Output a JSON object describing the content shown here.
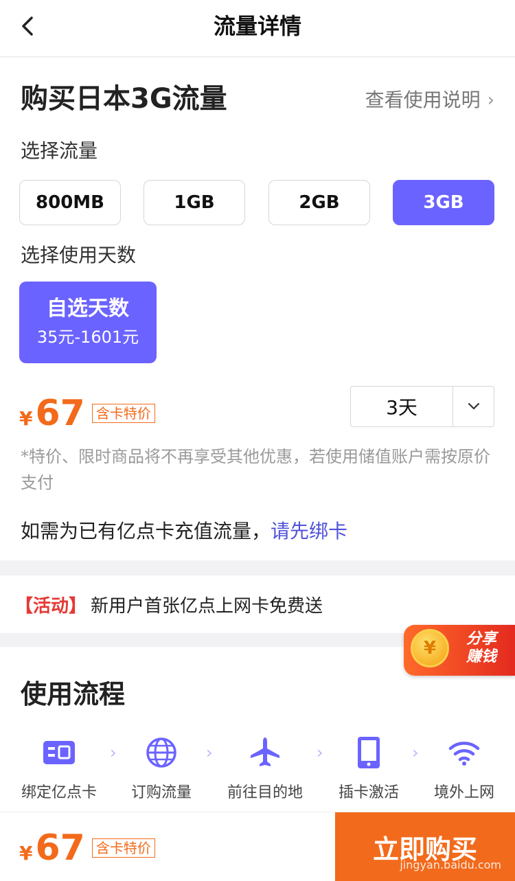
{
  "header": {
    "title": "流量详情"
  },
  "buy": {
    "title": "购买日本3G流量",
    "guide_link": "查看使用说明",
    "select_flow_label": "选择流量",
    "flow_options": [
      "800MB",
      "1GB",
      "2GB",
      "3GB"
    ],
    "selected_flow": "3GB",
    "select_days_label": "选择使用天数",
    "days_card_title": "自选天数",
    "days_card_range": "35元-1601元",
    "price_symbol": "¥",
    "price": "67",
    "price_badge": "含卡特价",
    "days_value": "3天",
    "note": "*特价、限时商品将不再享受其他优惠，若使用储值账户需按原价支付",
    "bind_text": "如需为已有亿点卡充值流量，",
    "bind_link": "请先绑卡"
  },
  "activity": {
    "tag": "【活动】",
    "text": "新用户首张亿点上网卡免费送"
  },
  "share": {
    "line1": "分享",
    "line2": "赚钱",
    "coin_symbol": "¥"
  },
  "flow": {
    "title": "使用流程",
    "steps": [
      {
        "label": "绑定亿点卡",
        "icon": "sim-card-icon"
      },
      {
        "label": "订购流量",
        "icon": "globe-icon"
      },
      {
        "label": "前往目的地",
        "icon": "airplane-icon"
      },
      {
        "label": "插卡激活",
        "icon": "phone-icon"
      },
      {
        "label": "境外上网",
        "icon": "wifi-icon"
      }
    ]
  },
  "bottom": {
    "price_symbol": "¥",
    "price": "67",
    "badge": "含卡特价",
    "buy_label": "立即购买"
  },
  "watermark": "jingyan.baidu.com",
  "colors": {
    "accent": "#6b63ff",
    "price": "#f26a1b",
    "link": "#4f51d8",
    "activity": "#e53935"
  }
}
